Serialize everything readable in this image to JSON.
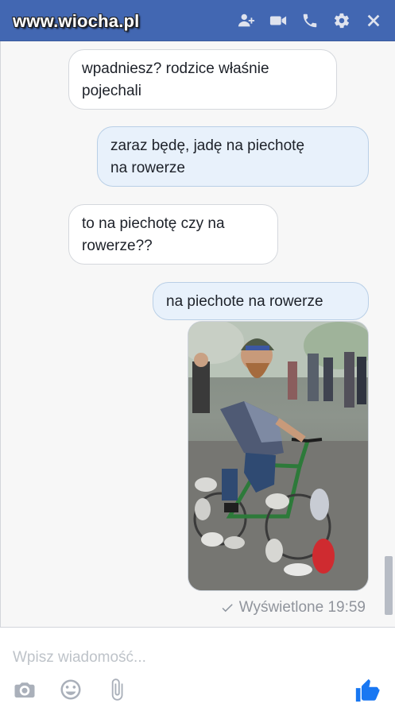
{
  "watermark": "www.wiocha.pl",
  "header": {
    "icons": [
      "add-people-icon",
      "video-call-icon",
      "phone-icon",
      "settings-icon",
      "close-icon"
    ],
    "background": "#4267b2"
  },
  "messages": [
    {
      "direction": "incoming",
      "text_lines": [
        "wpadniesz? rodzice właśnie",
        "pojechali"
      ]
    },
    {
      "direction": "outgoing",
      "text_lines": [
        "zaraz będę, jadę na piechotę",
        "na rowerze"
      ]
    },
    {
      "direction": "incoming",
      "text_lines": [
        "to na piechotę czy na",
        "rowerze??"
      ]
    },
    {
      "direction": "outgoing",
      "text_lines": [
        "na piechote na rowerze"
      ]
    }
  ],
  "photo": {
    "subject": "bearded man with helmet riding a bicycle with sneakers attached to the wheels"
  },
  "seen_status": "Wyświetlone 19:59",
  "composer": {
    "placeholder": "Wpisz wiadomość...",
    "tools": [
      "camera-icon",
      "emoji-icon",
      "attach-icon"
    ],
    "like_icon": "thumbs-up-icon",
    "like_color": "#1877f2"
  }
}
